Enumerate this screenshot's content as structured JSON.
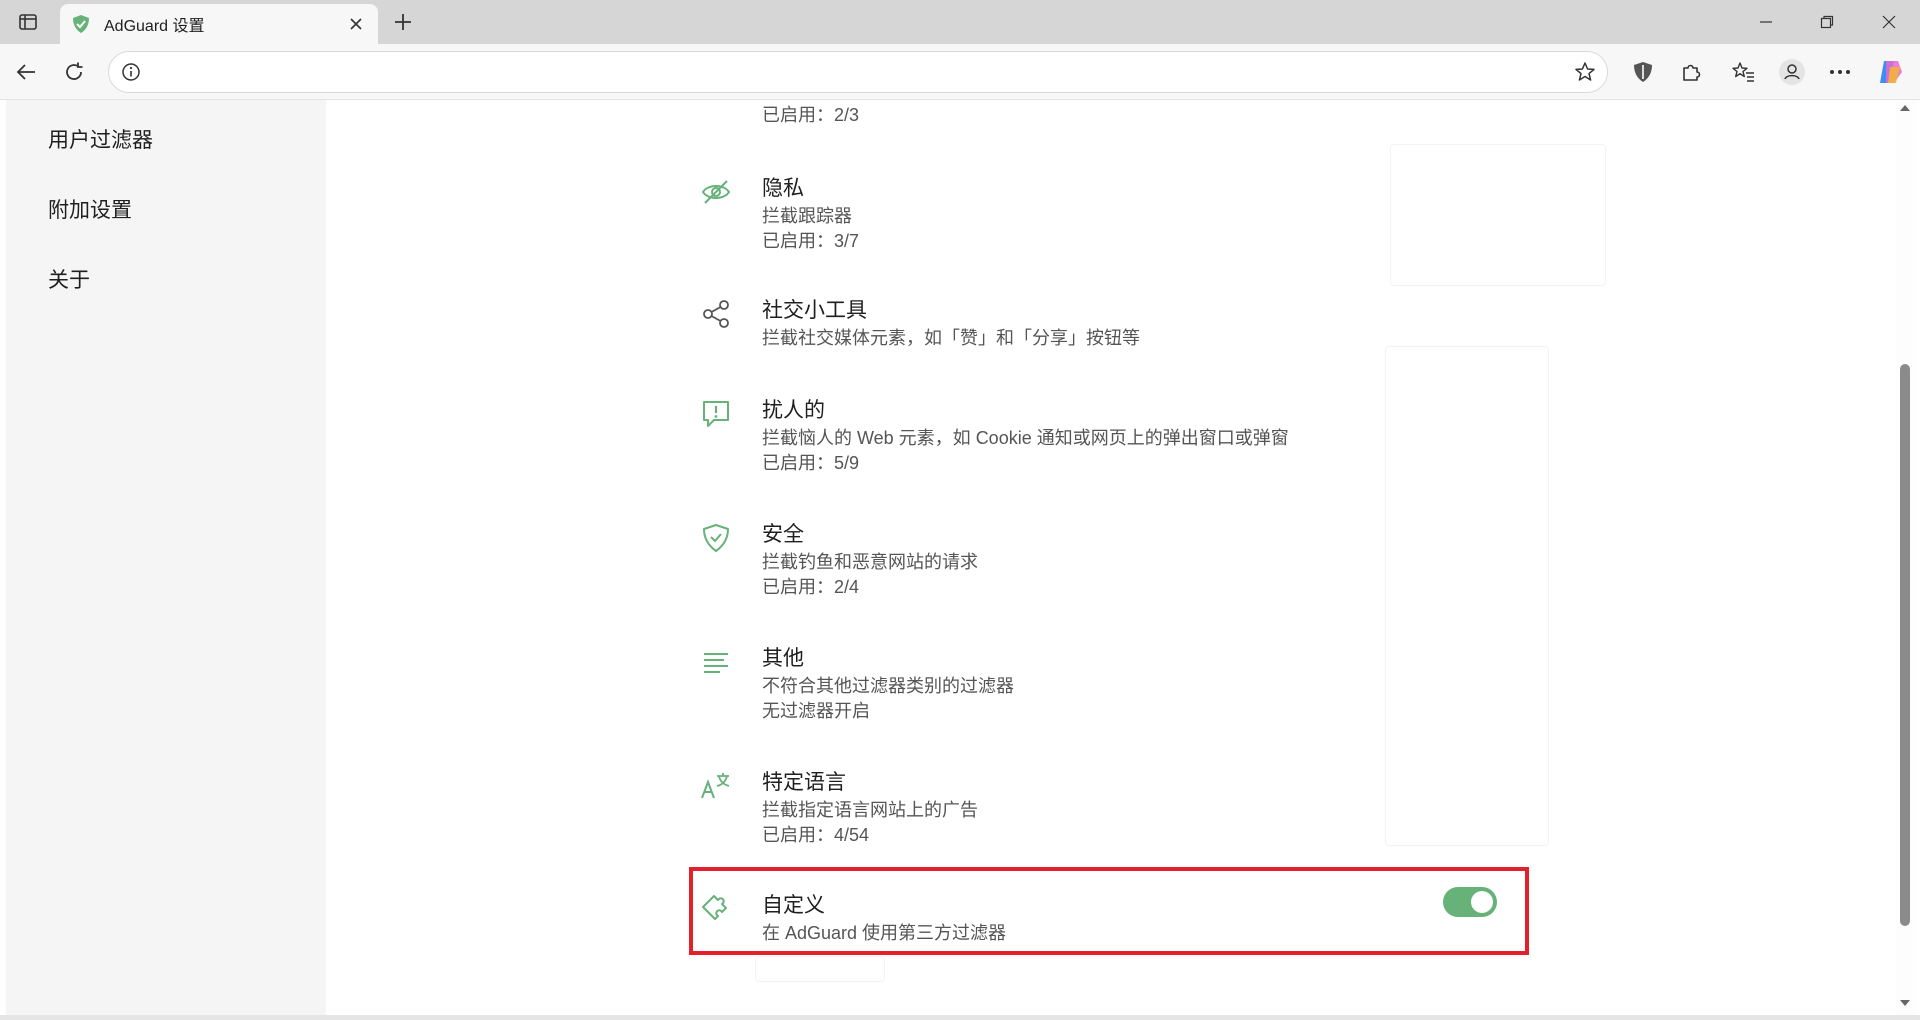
{
  "browser": {
    "tab_title": "AdGuard 设置",
    "url": ""
  },
  "sidebar": {
    "items": [
      {
        "label": "用户过滤器"
      },
      {
        "label": "附加设置"
      },
      {
        "label": "关于"
      }
    ]
  },
  "partial_top": {
    "count": "已启用：2/3"
  },
  "categories": [
    {
      "icon": "eye-slash-icon",
      "title": "隐私",
      "desc": "拦截跟踪器",
      "count": "已启用：3/7"
    },
    {
      "icon": "share-nodes-icon",
      "title": "社交小工具",
      "desc": "拦截社交媒体元素，如「赞」和「分享」按钮等",
      "count": ""
    },
    {
      "icon": "message-alert-icon",
      "title": "扰人的",
      "desc": "拦截恼人的 Web 元素，如 Cookie 通知或网页上的弹出窗口或弹窗",
      "count": "已启用：5/9"
    },
    {
      "icon": "shield-check-icon",
      "title": "安全",
      "desc": "拦截钓鱼和恶意网站的请求",
      "count": "已启用：2/4"
    },
    {
      "icon": "lines-icon",
      "title": "其他",
      "desc": "不符合其他过滤器类别的过滤器",
      "count": "无过滤器开启"
    },
    {
      "icon": "language-icon",
      "title": "特定语言",
      "desc": "拦截指定语言网站上的广告",
      "count": "已启用：4/54"
    },
    {
      "icon": "puzzle-icon",
      "title": "自定义",
      "desc": "在 AdGuard 使用第三方过滤器",
      "count": "",
      "toggle_on": true
    }
  ],
  "colors": {
    "accent": "#67b279",
    "highlight": "#e3202c"
  }
}
